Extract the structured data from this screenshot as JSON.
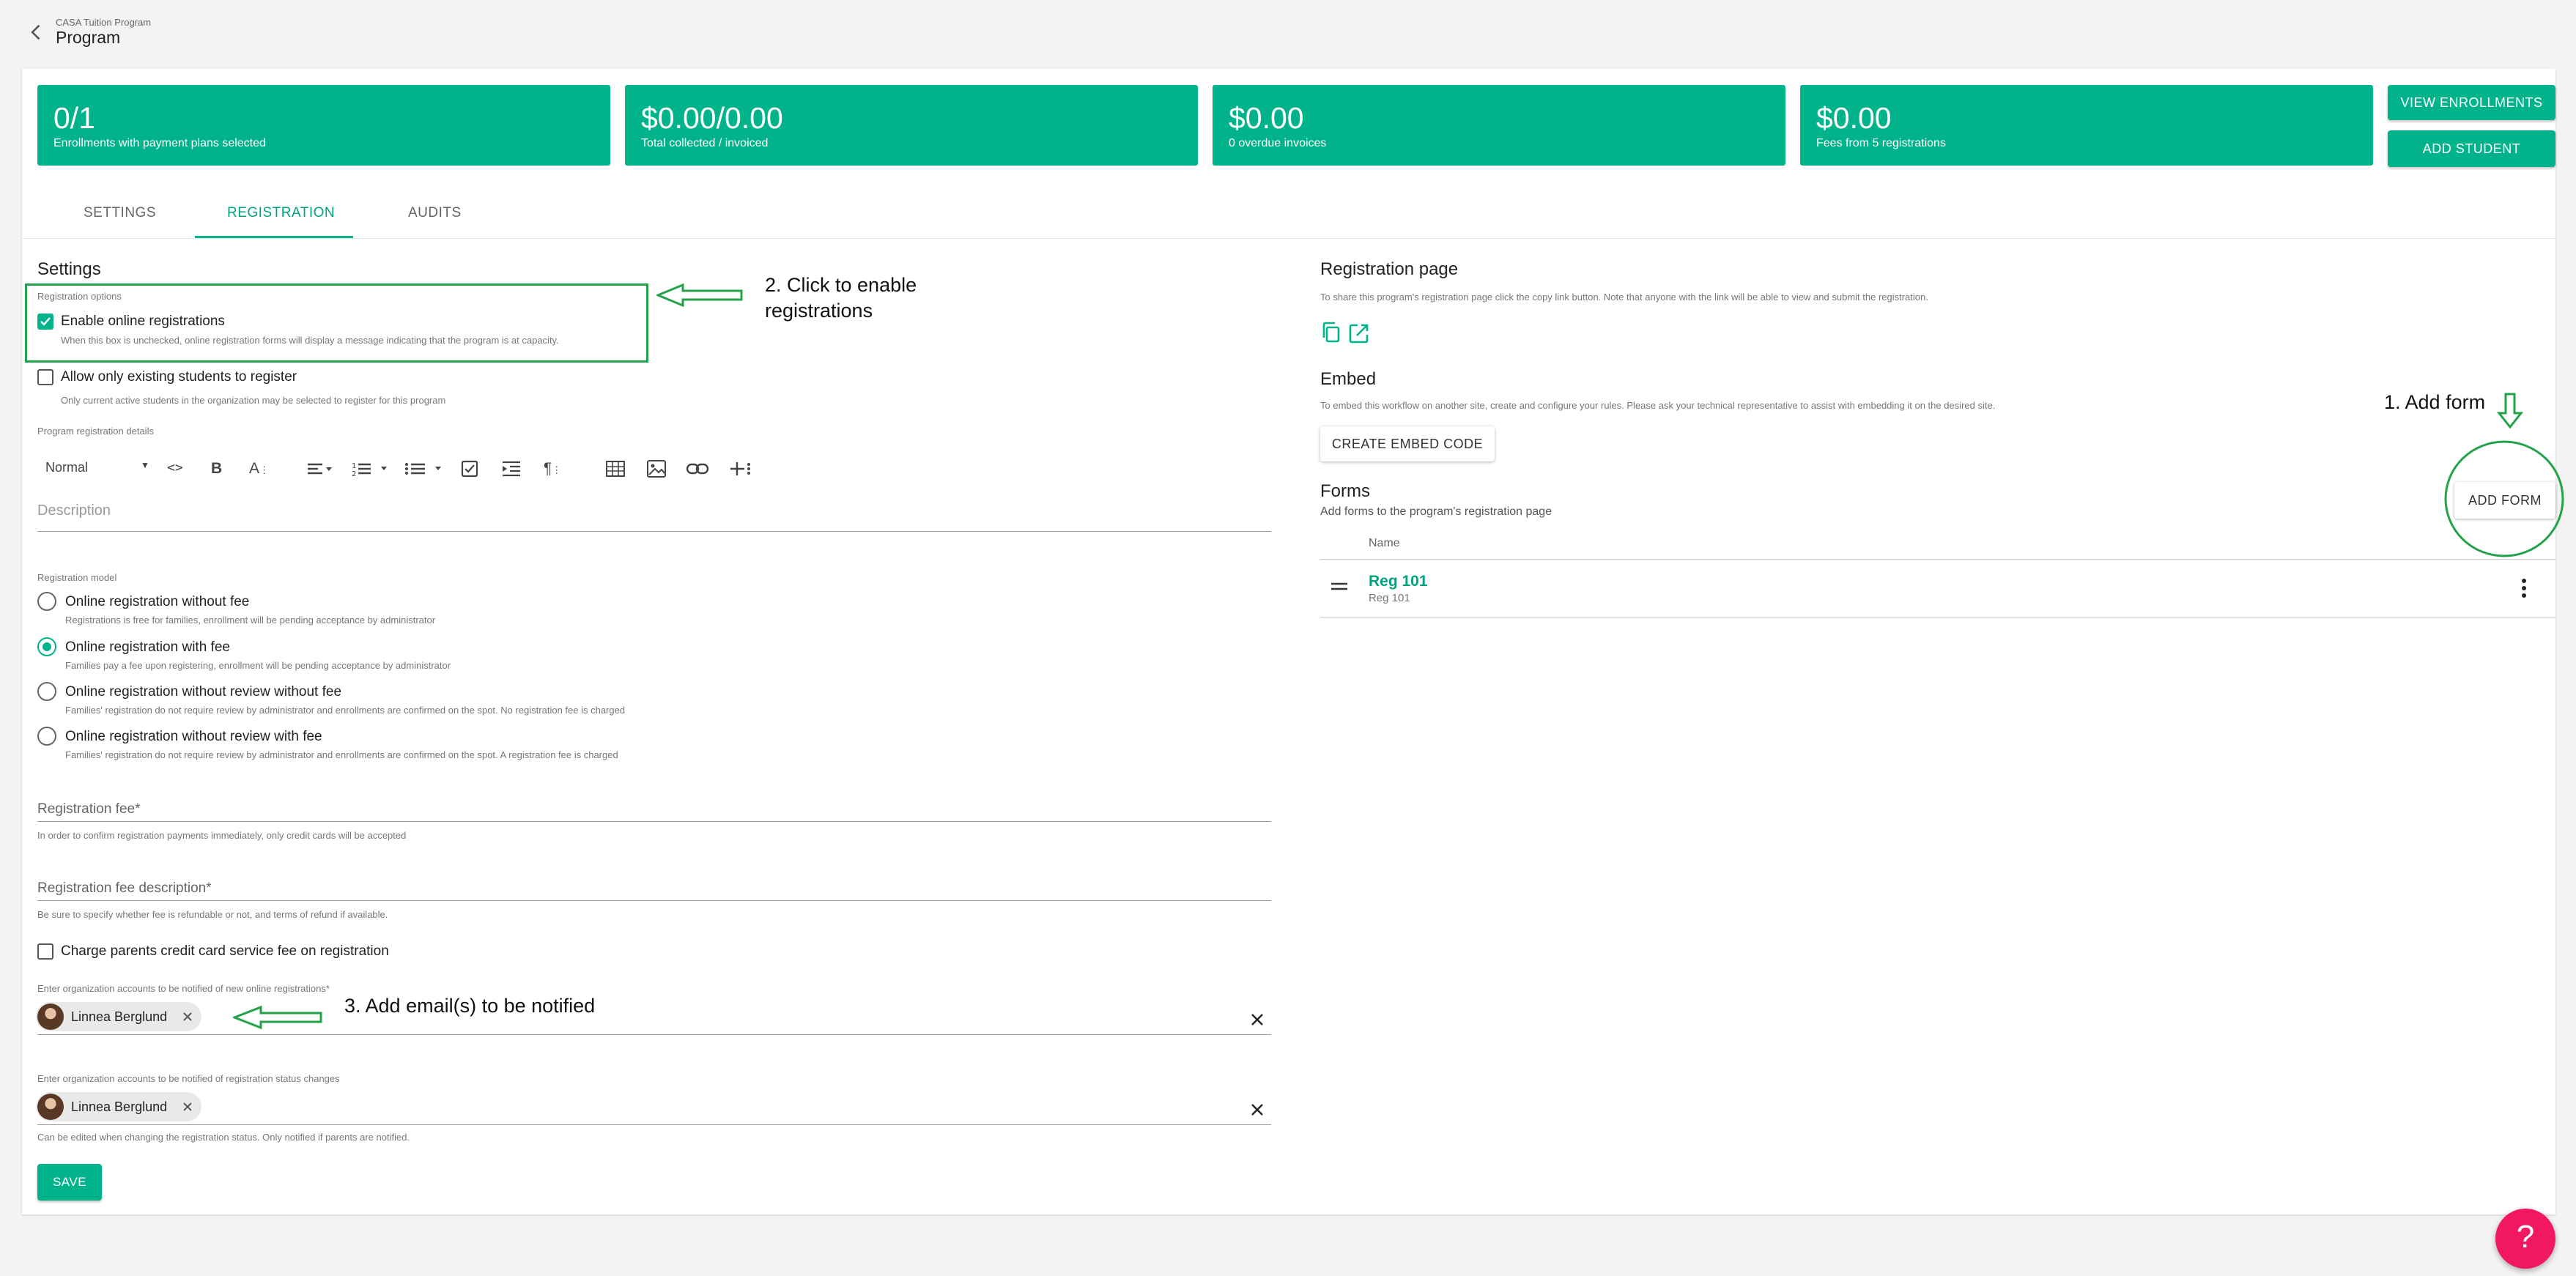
{
  "header": {
    "breadcrumb": "CASA Tuition Program",
    "title": "Program"
  },
  "stats": [
    {
      "value": "0/1",
      "label": "Enrollments with payment plans selected"
    },
    {
      "value": "$0.00/0.00",
      "label": "Total collected / invoiced"
    },
    {
      "value": "$0.00",
      "label": "0 overdue invoices"
    },
    {
      "value": "$0.00",
      "label": "Fees from 5 registrations"
    }
  ],
  "actions": {
    "view_enrollments": "VIEW ENROLLMENTS",
    "add_student": "ADD STUDENT"
  },
  "tabs": [
    {
      "label": "SETTINGS",
      "active": false
    },
    {
      "label": "REGISTRATION",
      "active": true
    },
    {
      "label": "AUDITS",
      "active": false
    }
  ],
  "settings": {
    "heading": "Settings",
    "registration_options_label": "Registration options",
    "enable_online": {
      "label": "Enable online registrations",
      "help": "When this box is unchecked, online registration forms will display a message indicating that the program is at capacity.",
      "checked": true
    },
    "existing_only": {
      "label": "Allow only existing students to register",
      "help": "Only current active students in the organization may be selected to register for this program",
      "checked": false
    },
    "details_label": "Program registration details",
    "editor": {
      "style_select": "Normal",
      "description_placeholder": "Description"
    },
    "model_label": "Registration model",
    "models": [
      {
        "label": "Online registration without fee",
        "help": "Registrations is free for families, enrollment will be pending acceptance by administrator",
        "selected": false
      },
      {
        "label": "Online registration with fee",
        "help": "Families pay a fee upon registering, enrollment will be pending acceptance by administrator",
        "selected": true
      },
      {
        "label": "Online registration without review without fee",
        "help": "Families' registration do not require review by administrator and enrollments are confirmed on the spot. No registration fee is charged",
        "selected": false
      },
      {
        "label": "Online registration without review with fee",
        "help": "Families' registration do not require review by administrator and enrollments are confirmed on the spot. A registration fee is charged",
        "selected": false
      }
    ],
    "fee": {
      "label": "Registration fee*",
      "help": "In order to confirm registration payments immediately, only credit cards will be accepted"
    },
    "fee_description": {
      "label": "Registration fee description*",
      "help": "Be sure to specify whether fee is refundable or not, and terms of refund if available."
    },
    "service_fee": {
      "label": "Charge parents credit card service fee on registration",
      "checked": false
    },
    "notify_new": {
      "label": "Enter organization accounts to be notified of new online registrations*",
      "chip": "Linnea Berglund"
    },
    "notify_status": {
      "label": "Enter organization accounts to be notified of registration status changes",
      "chip": "Linnea Berglund",
      "help": "Can be edited when changing the registration status. Only notified if parents are notified."
    },
    "save": "SAVE"
  },
  "registration_page": {
    "heading": "Registration page",
    "help": "To share this program's registration page click the copy link button. Note that anyone with the link will be able to view and submit the registration."
  },
  "embed": {
    "heading": "Embed",
    "help": "To embed this workflow on another site, create and configure your rules. Please ask your technical representative to assist with embedding it on the desired site.",
    "button": "CREATE EMBED CODE"
  },
  "forms": {
    "heading": "Forms",
    "help": "Add forms to the program's registration page",
    "add_button": "ADD FORM",
    "column_name": "Name",
    "rows": [
      {
        "title": "Reg 101",
        "subtitle": "Reg 101"
      }
    ]
  },
  "annotations": {
    "enable_line1": "2. Click to enable",
    "enable_line2": "registrations",
    "add_form": "1. Add form",
    "emails": "3. Add email(s) to be notified"
  },
  "help_button": "?",
  "colors": {
    "accent": "#00b38a",
    "annotation": "#22a34a",
    "help": "#f2185f"
  }
}
